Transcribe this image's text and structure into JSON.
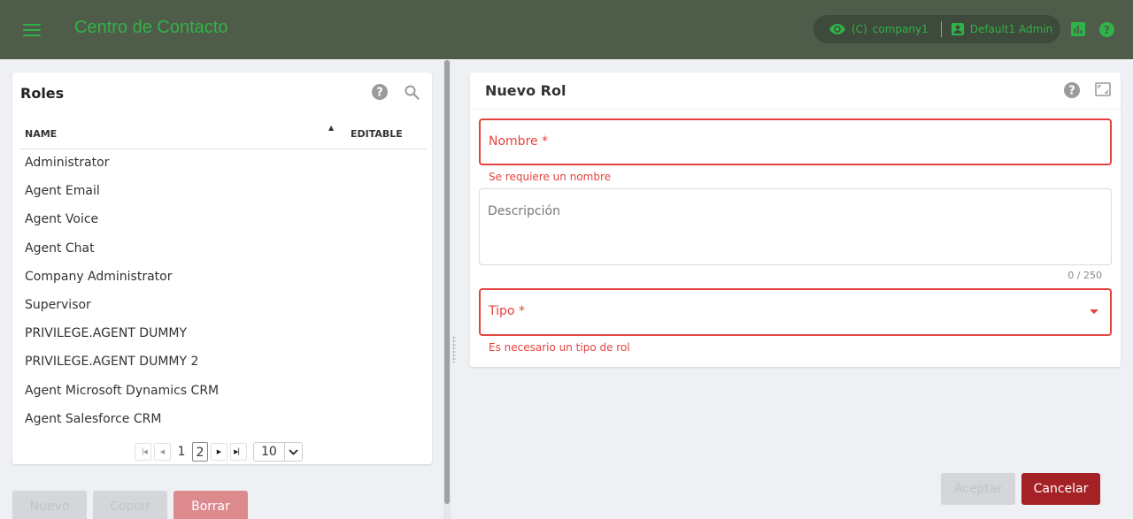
{
  "header": {
    "app_title": "Centro de Contacto",
    "context_label": "(C)",
    "company": "company1",
    "user": "Default1 Admin",
    "icons": [
      "menu-icon",
      "eye-icon",
      "user-card-icon",
      "report-icon",
      "help-icon"
    ]
  },
  "roles_panel": {
    "title": "Roles",
    "columns": {
      "name": "NAME",
      "editable": "EDITABLE"
    },
    "rows": [
      "Administrator",
      "Agent Email",
      "Agent Voice",
      "Agent Chat",
      "Company Administrator",
      "Supervisor",
      "PRIVILEGE.AGENT DUMMY",
      "PRIVILEGE.AGENT DUMMY 2",
      "Agent Microsoft Dynamics CRM",
      "Agent Salesforce CRM"
    ],
    "pagination": {
      "pages": [
        "1",
        "2"
      ],
      "current_page": "2",
      "page_size": "10"
    },
    "actions": {
      "nuevo": "Nuevo",
      "copiar": "Copiar",
      "borrar": "Borrar"
    }
  },
  "form": {
    "title": "Nuevo Rol",
    "nombre_label": "Nombre *",
    "nombre_error": "Se requiere un nombre",
    "descripcion_label": "Descripción",
    "descripcion_counter": "0 / 250",
    "tipo_label": "Tipo *",
    "tipo_error": "Es necesario un tipo de rol",
    "aceptar": "Aceptar",
    "cancelar": "Cancelar"
  },
  "colors": {
    "topbar": "#4f5c4a",
    "accent_green": "#2fb348",
    "error": "#e4433f",
    "cancel_button": "#a42126",
    "delete_button": "#dc8a8e"
  }
}
